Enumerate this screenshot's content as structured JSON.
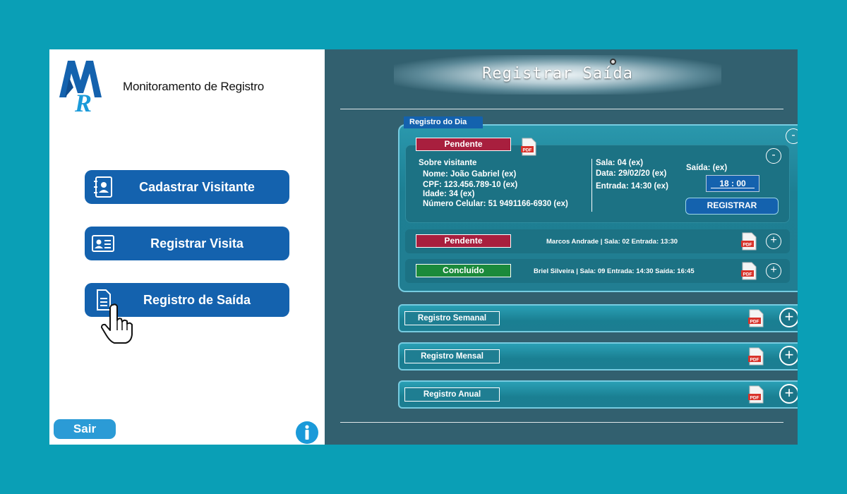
{
  "app": {
    "title": "Monitoramento de Registro"
  },
  "nav": {
    "items": [
      {
        "label": "Cadastrar Visitante",
        "icon": "contact-book-icon"
      },
      {
        "label": "Registrar Visita",
        "icon": "id-card-icon"
      },
      {
        "label": "Registro de Saída",
        "icon": "document-icon"
      }
    ],
    "active_pointer": "hand-pointer-icon"
  },
  "footer": {
    "logout_label": "Sair",
    "info_icon": "info-icon"
  },
  "page": {
    "title": "Registrar Saída"
  },
  "daily": {
    "tab_label": "Registro do Dia",
    "collapse_symbol": "-",
    "expanded": {
      "status": "Pendente",
      "section_title": "Sobre visitante",
      "nome": "Nome: João Gabriel (ex)",
      "cpf": "CPF: 123.456.789-10 (ex)",
      "idade": "Idade: 34 (ex)",
      "celular": "Número Celular: 51 9491166-6930 (ex)",
      "sala": "Sala: 04 (ex)",
      "data": "Data: 29/02/20 (ex)",
      "entrada": "Entrada: 14:30 (ex)",
      "saida_label": "Saída: (ex)",
      "saida_value": "18 : 00",
      "register_label": "REGISTRAR",
      "collapse_symbol": "-"
    },
    "rows": [
      {
        "status": "Pendente",
        "text": "Marcos Andrade | Sala: 02  Entrada: 13:30",
        "expand_symbol": "+"
      },
      {
        "status": "Concluído",
        "text": "Briel Silveira | Sala: 09  Entrada: 14:30  Saída: 16:45",
        "expand_symbol": "+"
      }
    ]
  },
  "sections": [
    {
      "label": "Registro Semanal",
      "expand_symbol": "+"
    },
    {
      "label": "Registro Mensal",
      "expand_symbol": "+"
    },
    {
      "label": "Registro Anual",
      "expand_symbol": "+"
    }
  ],
  "pdf_label": "PDF",
  "colors": {
    "background": "#0a9fb6",
    "primary_blue": "#1462ae",
    "panel_dark": "#32606f",
    "pending_red": "#a81f3e",
    "done_green": "#1b8a3b",
    "logout_blue": "#2b9bd6"
  }
}
